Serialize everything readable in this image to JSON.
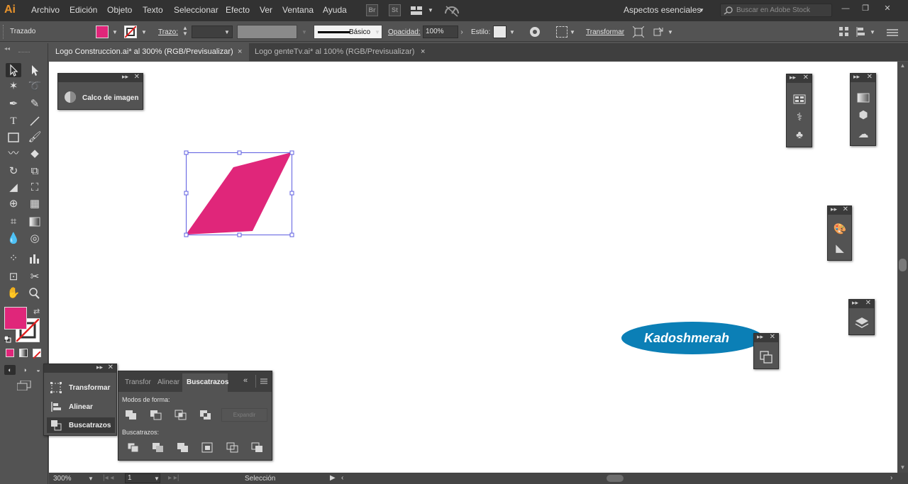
{
  "app": {
    "logo": "Ai"
  },
  "menu": [
    "Archivo",
    "Edición",
    "Objeto",
    "Texto",
    "Seleccionar",
    "Efecto",
    "Ver",
    "Ventana",
    "Ayuda"
  ],
  "menubar_icons": {
    "bridge": "Br",
    "stock": "St",
    "arrange_docs": "arrange-documents-icon",
    "gpu": "gpu-performance-icon"
  },
  "workspace": "Aspectos esenciales",
  "stock_search": {
    "placeholder": "Buscar en Adobe Stock"
  },
  "window_controls": {
    "minimize": "—",
    "restore": "❐",
    "close": "✕"
  },
  "controlbar": {
    "object_type": "Trazado",
    "stroke_label": "Trazo:",
    "stroke_value": "",
    "brush_label": "Básico",
    "opacity_label": "Opacidad:",
    "opacity_value": "100%",
    "style_label": "Estilo:",
    "transform_label": "Transformar",
    "fill_color": "#e0267a"
  },
  "tabs": [
    {
      "label": "Logo Construccion.ai* al 300% (RGB/Previsualizar)",
      "active": true
    },
    {
      "label": "Logo genteTv.ai* al 100% (RGB/Previsualizar)",
      "active": false
    }
  ],
  "tab_close": "×",
  "image_trace_panel": {
    "label": "Calco de imagen"
  },
  "mini_panel": {
    "items": [
      {
        "label": "Transformar",
        "icon": "transform-icon"
      },
      {
        "label": "Alinear",
        "icon": "align-icon"
      },
      {
        "label": "Buscatrazos",
        "icon": "pathfinder-icon"
      }
    ]
  },
  "pathfinder_panel": {
    "tabs": [
      "Transfor",
      "Alinear",
      "Buscatrazos"
    ],
    "active_tab": "Buscatrazos",
    "shape_modes_label": "Modos de forma:",
    "expand_label": "Expandir",
    "pathfinders_label": "Buscatrazos:"
  },
  "artwork": {
    "shape_color": "#e0267a",
    "selection_color": "#5c5ce0",
    "logo_text": "Kadoshmerah",
    "logo_bg": "#0b7fb6"
  },
  "statusbar": {
    "zoom": "300%",
    "artboard": "1",
    "tool_status": "Selección"
  },
  "colors": {
    "fill": "#e0267a",
    "stroke": "none"
  }
}
